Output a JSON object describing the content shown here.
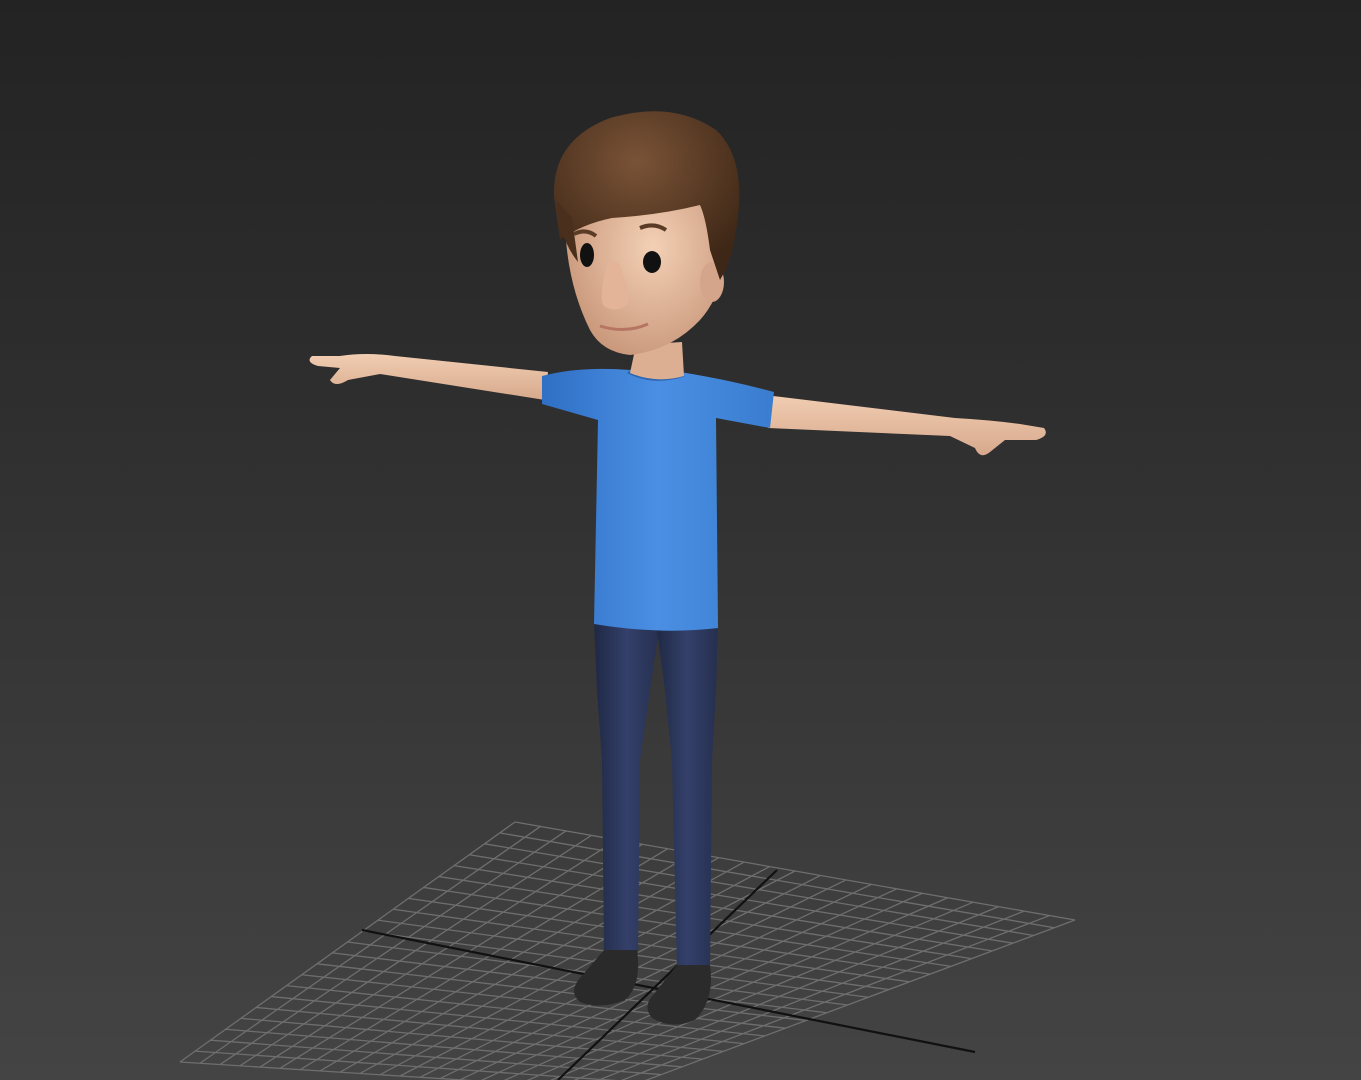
{
  "viewport": {
    "background_top": "#232323",
    "background_bottom": "#444444",
    "grid_color": "#6e6e6e",
    "axis_color": "#111111"
  },
  "character": {
    "pose": "T-pose",
    "hair_color": "#5a3b26",
    "skin_color": "#e6bfa2",
    "shirt_color": "#3f84d8",
    "pants_color": "#2b3656",
    "shoe_color": "#2a2a2a"
  }
}
